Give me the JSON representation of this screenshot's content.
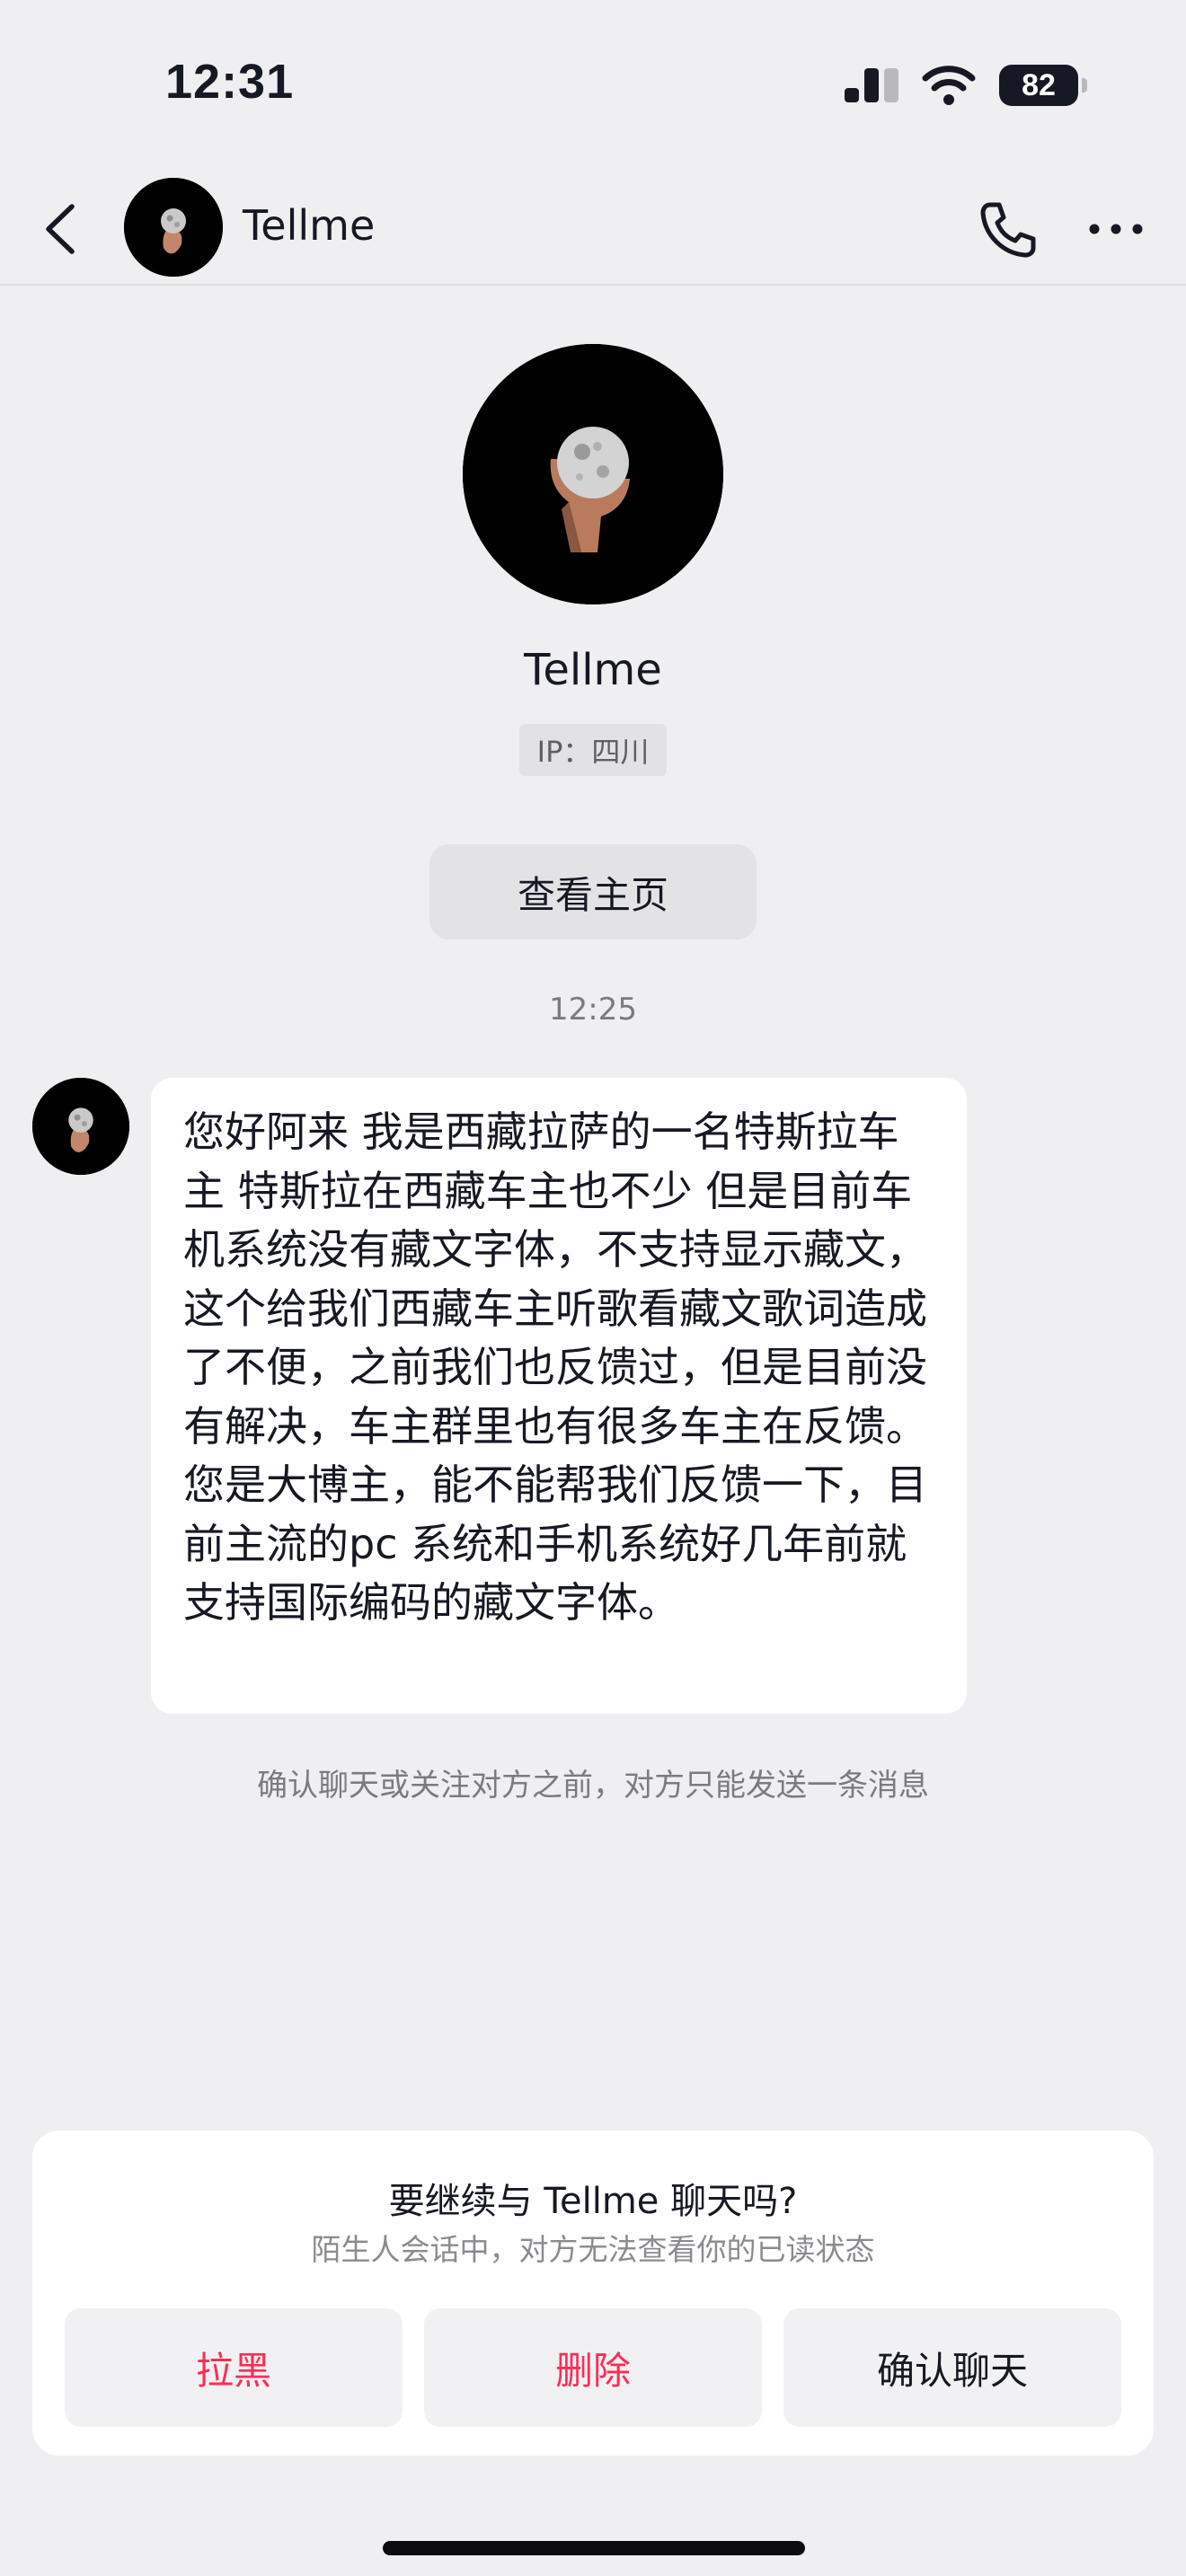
{
  "status_bar": {
    "time": "12:31",
    "battery_level": "82"
  },
  "header": {
    "contact_name": "Tellme"
  },
  "profile": {
    "name": "Tellme",
    "ip_label": "IP：四川",
    "view_homepage_label": "查看主页"
  },
  "conversation": {
    "timestamp": "12:25",
    "message": "您好阿来 我是西藏拉萨的一名特斯拉车主 特斯拉在西藏车主也不少 但是目前车机系统没有藏文字体，不支持显示藏文，这个给我们西藏车主听歌看藏文歌词造成了不便，之前我们也反馈过，但是目前没有解决，车主群里也有很多车主在反馈。您是大博主，能不能帮我们反馈一下，目前主流的pc 系统和手机系统好几年前就支持国际编码的藏文字体。",
    "limit_notice": "确认聊天或关注对方之前，对方只能发送一条消息"
  },
  "stranger_prompt": {
    "title": "要继续与 Tellme 聊天吗?",
    "subtitle": "陌生人会话中，对方无法查看你的已读状态",
    "block_label": "拉黑",
    "delete_label": "删除",
    "confirm_label": "确认聊天"
  },
  "colors": {
    "accent_red": "#fe2c55",
    "background": "#efeff1"
  },
  "icons": [
    "signal-icon",
    "wifi-icon",
    "battery-icon",
    "back-arrow-icon",
    "phone-icon",
    "more-icon"
  ]
}
